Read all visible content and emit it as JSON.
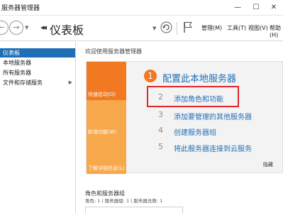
{
  "window": {
    "title": "服务器管理器",
    "min_glyph": "—",
    "max_glyph": "☐",
    "close_glyph": "✕"
  },
  "toolbar": {
    "page_title": "仪表板",
    "breadcrumb_arrows": "◂◂",
    "menus": {
      "manage": "管理(M)",
      "tools": "工具(T)",
      "view": "视图(V)",
      "help": "帮助(H)"
    }
  },
  "sidebar": {
    "items": [
      {
        "label": "仪表板",
        "active": true
      },
      {
        "label": "本地服务器",
        "active": false
      },
      {
        "label": "所有服务器",
        "active": false
      },
      {
        "label": "文件和存储服务",
        "active": false
      }
    ],
    "expand_glyph": "▶"
  },
  "welcome": {
    "heading": "欢迎使用服务器管理器",
    "tiles": {
      "quick_start": "快速启动(Q)",
      "new_features": "新增功能(W)",
      "learn_more": "了解详细信息(L)"
    },
    "config": {
      "number": "1",
      "title": "配置此本地服务器"
    },
    "steps": [
      {
        "num": "2",
        "label": "添加角色和功能"
      },
      {
        "num": "3",
        "label": "添加要管理的其他服务器"
      },
      {
        "num": "4",
        "label": "创建服务器组"
      },
      {
        "num": "5",
        "label": "将此服务器连接到云服务"
      }
    ],
    "hide_label": "隐藏"
  },
  "roles": {
    "title": "角色和服务器组",
    "stats": "角色: 1 | 服务器组: 1 | 服务器总数: 1"
  },
  "colors": {
    "accent": "#1f6fb7",
    "orange": "#f07922",
    "orange_light": "#f7a84a",
    "highlight": "#e2262b"
  }
}
